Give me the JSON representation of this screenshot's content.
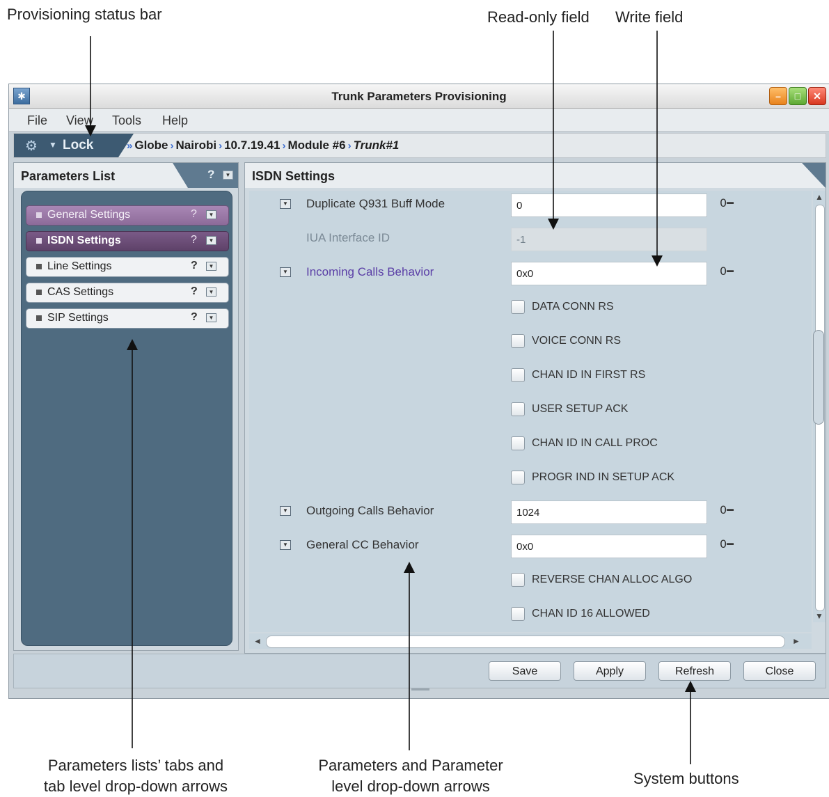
{
  "annotations": {
    "provisioning_status_bar": "Provisioning status bar",
    "read_only_field": "Read-only field",
    "write_field": "Write field",
    "tabs_line1": "Parameters lists’ tabs and",
    "tabs_line2": "tab level drop-down arrows",
    "params_line1": "Parameters and Parameter",
    "params_line2": "level drop-down arrows",
    "system_buttons": "System buttons"
  },
  "window": {
    "title": "Trunk Parameters Provisioning"
  },
  "menu": [
    "File",
    "View",
    "Tools",
    "Help"
  ],
  "status_bar": {
    "lock_label": "Lock",
    "breadcrumb": [
      "Globe",
      "Nairobi",
      "10.7.19.41",
      "Module #6",
      "Trunk#1"
    ]
  },
  "parameters_list": {
    "title": "Parameters List",
    "tabs": [
      {
        "label": "General Settings",
        "selected": false
      },
      {
        "label": "ISDN Settings",
        "selected": true
      },
      {
        "label": "Line Settings",
        "selected": false
      },
      {
        "label": "CAS Settings",
        "selected": false
      },
      {
        "label": "SIP Settings",
        "selected": false
      }
    ]
  },
  "isdn_settings": {
    "title": "ISDN Settings",
    "params": {
      "dup_q931": {
        "label": "Duplicate Q931 Buff Mode",
        "value": "0"
      },
      "iua_interface": {
        "label": "IUA Interface ID",
        "value": "-1"
      },
      "incoming_calls": {
        "label": "Incoming Calls Behavior",
        "value": "0x0"
      },
      "outgoing_calls": {
        "label": "Outgoing Calls Behavior",
        "value": "1024"
      },
      "general_cc": {
        "label": "General CC Behavior",
        "value": "0x0"
      }
    },
    "incoming_flags": [
      "DATA CONN RS",
      "VOICE CONN RS",
      "CHAN ID IN FIRST RS",
      "USER SETUP ACK",
      "CHAN ID IN CALL PROC",
      "PROGR IND IN SETUP ACK"
    ],
    "general_cc_flags": [
      "REVERSE CHAN ALLOC ALGO",
      "CHAN ID 16 ALLOWED"
    ]
  },
  "buttons": {
    "save": "Save",
    "apply": "Apply",
    "refresh": "Refresh",
    "close": "Close"
  },
  "icons": {
    "key": "key-icon",
    "dropdown": "dropdown-arrow-icon",
    "help": "help-icon"
  }
}
